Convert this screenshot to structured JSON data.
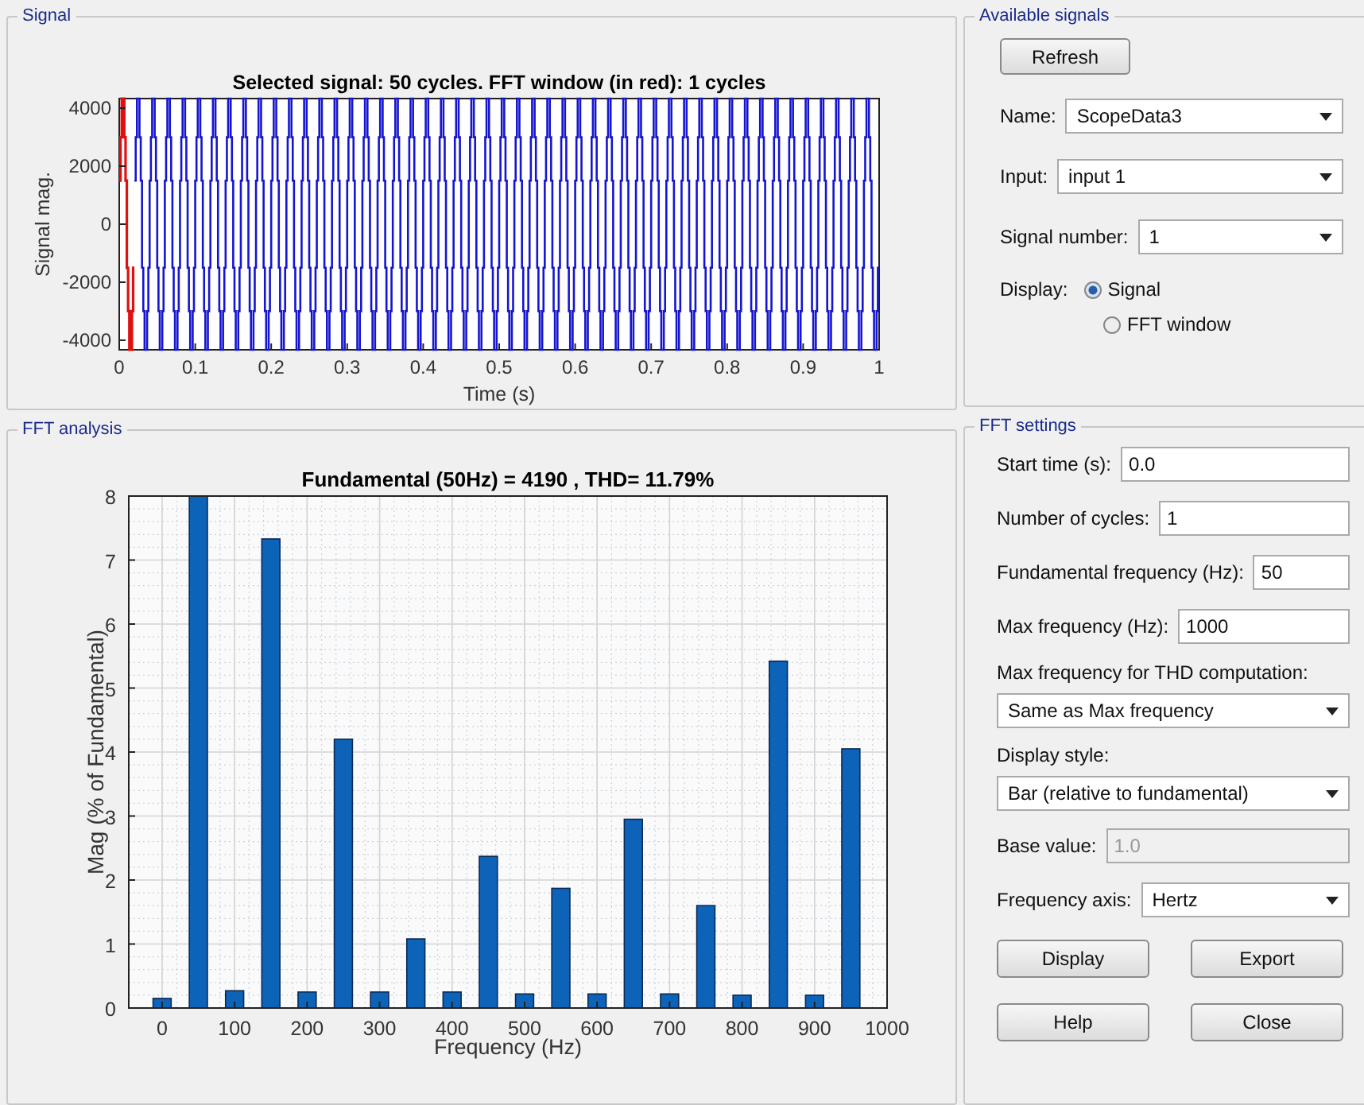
{
  "signal_panel": {
    "title": "Signal",
    "plot": {
      "title": "Selected signal: 50 cycles. FFT window (in red): 1 cycles",
      "xlabel": "Time (s)",
      "ylabel": "Signal mag.",
      "xtick_labels": [
        "0",
        "0.1",
        "0.2",
        "0.3",
        "0.4",
        "0.5",
        "0.6",
        "0.7",
        "0.8",
        "0.9",
        "1"
      ],
      "ytick_labels": [
        "4000",
        "2000",
        "0",
        "-2000",
        "-4000"
      ]
    }
  },
  "fft_panel": {
    "title": "FFT analysis",
    "chart_data": {
      "type": "bar",
      "title": "Fundamental (50Hz) = 4190 , THD= 11.79%",
      "xlabel": "Frequency (Hz)",
      "ylabel": "Mag (% of Fundamental)",
      "x": [
        0,
        50,
        100,
        150,
        200,
        250,
        300,
        350,
        400,
        450,
        500,
        550,
        600,
        650,
        700,
        750,
        800,
        850,
        900,
        950
      ],
      "values": [
        0.15,
        8,
        0.27,
        7.33,
        0.25,
        4.2,
        0.25,
        1.08,
        0.25,
        2.37,
        0.22,
        1.87,
        0.22,
        2.95,
        0.22,
        1.6,
        0.2,
        5.42,
        0.2,
        4.05
      ],
      "xlim": [
        -46,
        1000
      ],
      "ylim": [
        0,
        8
      ],
      "xticks": [
        0,
        100,
        200,
        300,
        400,
        500,
        600,
        700,
        800,
        900,
        1000
      ],
      "yticks": [
        0,
        1,
        2,
        3,
        4,
        5,
        6,
        7,
        8
      ],
      "grid": true
    }
  },
  "available_signals": {
    "title": "Available signals",
    "refresh_button": "Refresh",
    "fields": [
      {
        "kind": "dropdown",
        "label": "Name:",
        "value": "ScopeData3"
      },
      {
        "kind": "dropdown",
        "label": "Input:",
        "value": "input 1"
      },
      {
        "kind": "dropdown",
        "label": "Signal number:",
        "value": "1"
      }
    ],
    "display": {
      "label": "Display:",
      "options": [
        {
          "label": "Signal",
          "selected": true
        },
        {
          "label": "FFT window",
          "selected": false
        }
      ]
    }
  },
  "fft_settings": {
    "title": "FFT settings",
    "fields": [
      {
        "kind": "text",
        "label": "Start time (s):",
        "value": "0.0",
        "disabled": false
      },
      {
        "kind": "text",
        "label": "Number of cycles:",
        "value": "1",
        "disabled": false
      },
      {
        "kind": "text",
        "label": "Fundamental frequency (Hz):",
        "value": "50",
        "disabled": false
      },
      {
        "kind": "text",
        "label": "Max frequency (Hz):",
        "value": "1000",
        "disabled": false
      },
      {
        "kind": "stacked_dropdown",
        "label": "Max frequency for THD computation:",
        "value": "Same as Max frequency",
        "disabled": false
      },
      {
        "kind": "stacked_dropdown",
        "label": "Display style:",
        "value": "Bar (relative to fundamental)",
        "disabled": false
      },
      {
        "kind": "text",
        "label": "Base value:",
        "value": "1.0",
        "disabled": true
      },
      {
        "kind": "dropdown",
        "label": "Frequency axis:",
        "value": "Hertz",
        "disabled": false
      }
    ],
    "buttons": [
      "Display",
      "Export",
      "Help",
      "Close"
    ]
  }
}
